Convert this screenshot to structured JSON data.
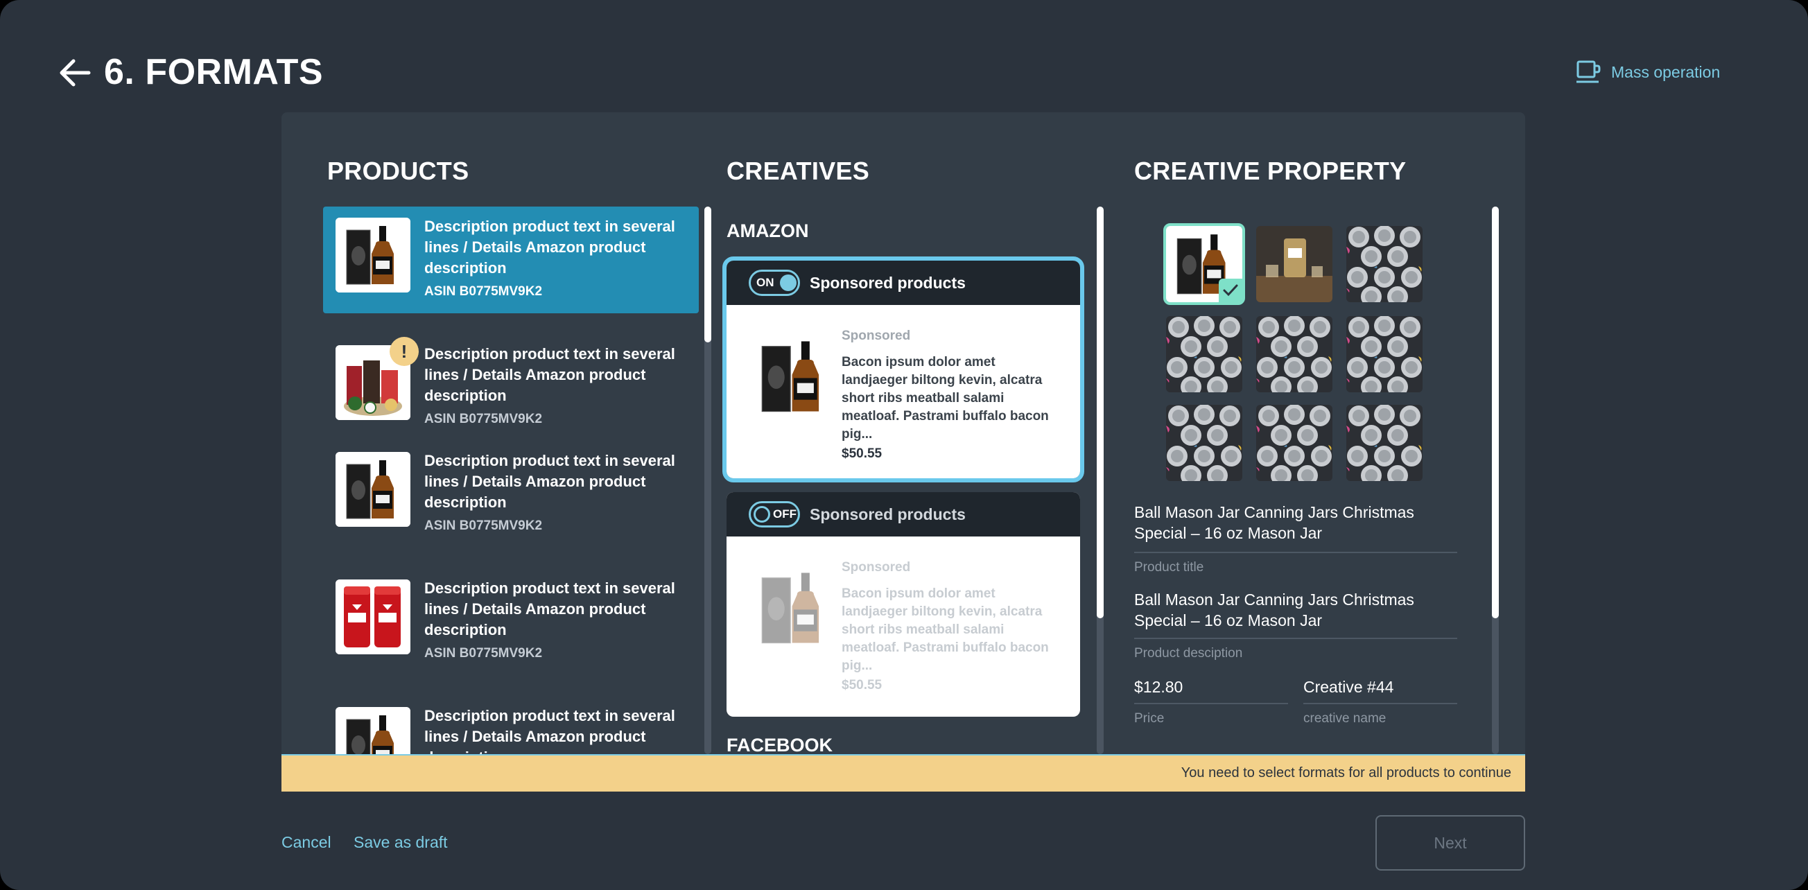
{
  "header": {
    "title": "6. FORMATS",
    "mass_operation": "Mass operation"
  },
  "columns": {
    "products": "PRODUCTS",
    "creatives": "CREATIVES",
    "property": "CREATIVE PROPERTY"
  },
  "products": [
    {
      "desc": "Description product text in several lines / Details Amazon product description",
      "asin": "ASIN B0775MV9K2",
      "selected": true,
      "thumb": "whiskey-bottle"
    },
    {
      "desc": "Description product text in several lines / Details Amazon product description",
      "asin": "ASIN B0775MV9K2",
      "warning": "!",
      "thumb": "gift-basket"
    },
    {
      "desc": "Description product text in several lines / Details Amazon product description",
      "asin": "ASIN B0775MV9K2",
      "thumb": "whiskey-bottle"
    },
    {
      "desc": "Description product text in several lines / Details Amazon product description",
      "asin": "ASIN B0775MV9K2",
      "thumb": "deodorant-pack"
    },
    {
      "desc": "Description product text in several lines / Details Amazon product description",
      "asin": "ASIN B0775MV9K2",
      "thumb": "whiskey-bottle"
    }
  ],
  "creatives": {
    "amazon_label": "AMAZON",
    "facebook_label": "FACEBOOK",
    "cards": [
      {
        "toggle": "ON",
        "title": "Sponsored products",
        "sponsored": "Sponsored",
        "text": "Bacon ipsum dolor amet landjaeger biltong kevin, alcatra short ribs meatball salami meatloaf. Pastrami buffalo bacon pig...",
        "price": "$50.55",
        "active": true
      },
      {
        "toggle": "OFF",
        "title": "Sponsored products",
        "sponsored": "Sponsored",
        "text": "Bacon ipsum dolor amet landjaeger biltong kevin, alcatra short ribs meatball salami meatloaf. Pastrami buffalo bacon pig...",
        "price": "$50.55",
        "active": false
      }
    ]
  },
  "property": {
    "gallery_selected_index": 0,
    "title_value": "Ball Mason Jar Canning Jars Christmas Special – 16 oz Mason Jar",
    "title_label": "Product title",
    "desc_value": "Ball Mason Jar Canning Jars Christmas Special – 16 oz Mason Jar",
    "desc_label": "Product desciption",
    "price_value": "$12.80",
    "price_label": "Price",
    "name_value": "Creative #44",
    "name_label": "creative name"
  },
  "notice": "You need to select formats for all products to continue",
  "footer": {
    "cancel": "Cancel",
    "save_draft": "Save as draft",
    "next": "Next"
  },
  "colors": {
    "background": "#2b333d",
    "panel": "#333d47",
    "accent": "#7ccbe3",
    "selected_row": "#238db3",
    "notice": "#f3d18a",
    "check": "#7ee0c8"
  }
}
